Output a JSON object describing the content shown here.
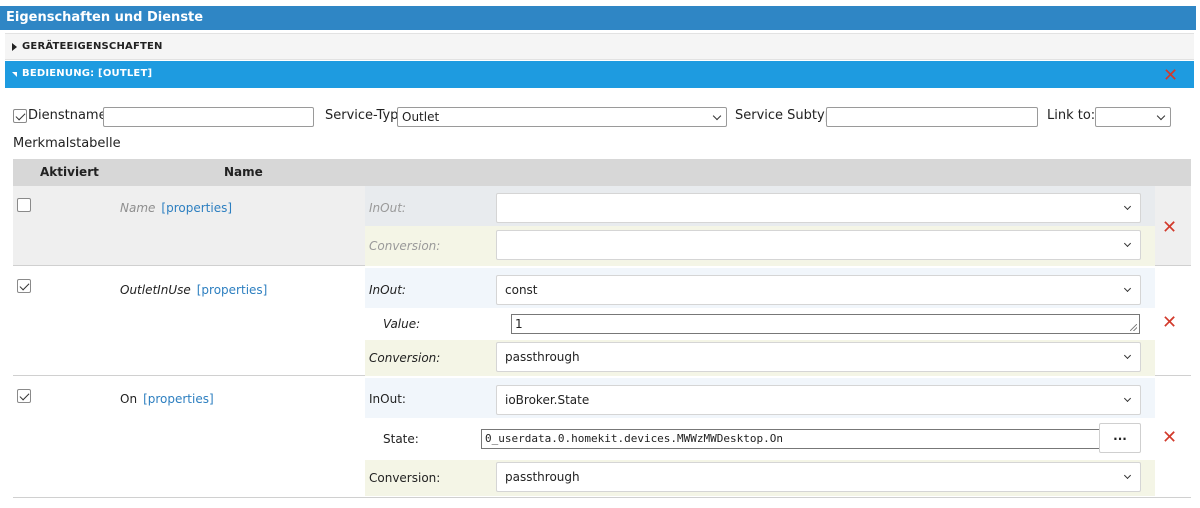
{
  "panel": {
    "title": "Eigenschaften und Dienste"
  },
  "sections": {
    "device_props": "GERÄTEEIGENSCHAFTEN",
    "service": "BEDIENUNG: [OUTLET]"
  },
  "service_form": {
    "dienstname_label": "Dienstname:",
    "dienstname_value": "",
    "dienstname_checked": true,
    "service_typ_label": "Service-Typ:",
    "service_typ_value": "Outlet",
    "service_subtyp_label": "Service Subtyp:",
    "service_subtyp_value": "",
    "link_to_label": "Link to:",
    "link_to_value": ""
  },
  "table": {
    "title": "Merkmalstabelle",
    "headers": {
      "aktiviert": "Aktiviert",
      "name": "Name"
    },
    "rows": [
      {
        "name": "Name",
        "link": "[properties]",
        "checked": false,
        "inout_label": "InOut:",
        "inout_value": "",
        "conversion_label": "Conversion:",
        "conversion_value": ""
      },
      {
        "name": "OutletInUse",
        "link": "[properties]",
        "checked": true,
        "inout_label": "InOut:",
        "inout_value": "const",
        "extra_label": "Value:",
        "extra_value": "1",
        "conversion_label": "Conversion:",
        "conversion_value": "passthrough"
      },
      {
        "name": "On",
        "link": "[properties]",
        "checked": true,
        "inout_label": "InOut:",
        "inout_value": "ioBroker.State",
        "extra_label": "State:",
        "extra_value": "0_userdata.0.homekit.devices.MWWzMWDesktop.On",
        "browse_label": "...",
        "conversion_label": "Conversion:",
        "conversion_value": "passthrough"
      }
    ]
  },
  "icons": {
    "delete": "delete-x-icon",
    "expand": "triangle-right-icon",
    "collapse": "triangle-down-icon",
    "dropdown": "chevron-down-icon"
  },
  "colors": {
    "title_bar": "#2f86c5",
    "active_section": "#1e9be0",
    "delete": "#d23a2c",
    "link": "#2d7fc0"
  }
}
